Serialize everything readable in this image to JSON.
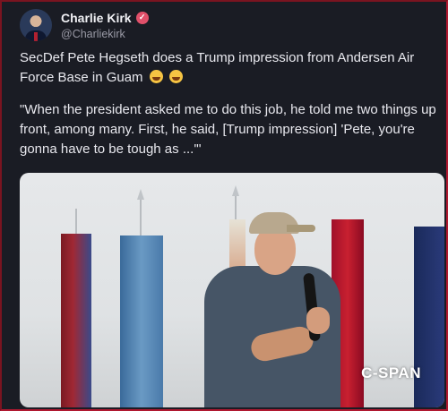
{
  "author": {
    "display_name": "Charlie Kirk",
    "handle": "@Charliekirk",
    "verified_icon": "verified-badge-icon"
  },
  "tweet": {
    "line1": "SecDef Pete Hegseth does a Trump impression from Andersen Air Force Base in Guam",
    "line1_emojis": [
      "laughing-emoji-icon",
      "laughing-emoji-icon"
    ],
    "quote": "\"When the president asked me to do this job, he told me two things up front, among many. First, he said, [Trump impression] 'Pete, you're gonna have to be tough as ...'\""
  },
  "media": {
    "watermark": "C-SPAN"
  },
  "colors": {
    "background": "#1a1c24",
    "accent_border": "#b01830",
    "verified": "#e0506a"
  }
}
